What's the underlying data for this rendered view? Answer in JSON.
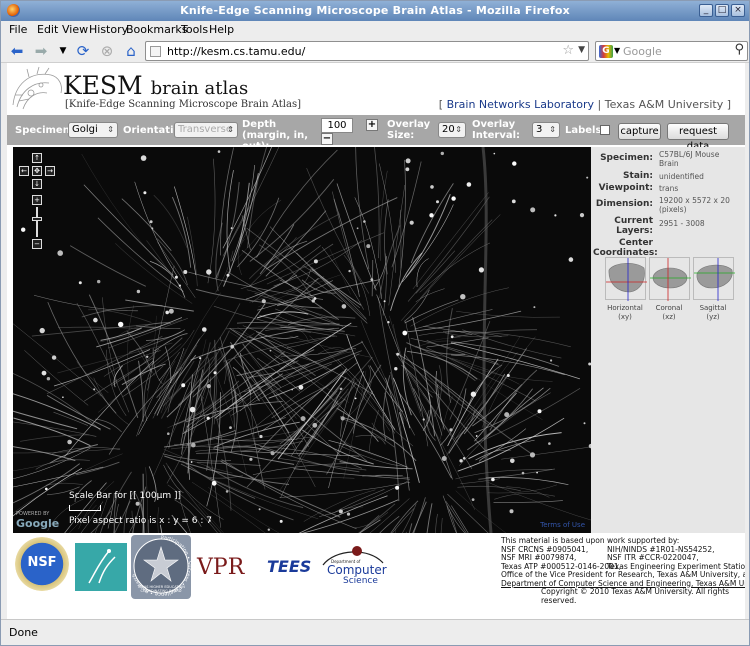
{
  "window": {
    "title": "Knife-Edge Scanning Microscope Brain Atlas - Mozilla Firefox",
    "controls": [
      "_",
      "□",
      "×"
    ]
  },
  "menu": [
    "File",
    "Edit",
    "View",
    "History",
    "Bookmarks",
    "Tools",
    "Help"
  ],
  "nav": {
    "back_icon": "back-arrow-icon",
    "forward_icon": "forward-arrow-icon",
    "reload_icon": "reload-icon",
    "stop_icon": "stop-icon",
    "home_icon": "home-icon",
    "url": "http://kesm.cs.tamu.edu/",
    "search_placeholder": "Google",
    "search_engine_glyph": "G"
  },
  "banner": {
    "logo_big": "KESM",
    "logo_small": "brain atlas",
    "subtitle": "[Knife-Edge Scanning Microscope Brain Atlas]",
    "lab_link": "Brain Networks Laboratory",
    "university": "Texas A&M University",
    "bracket_open": "[",
    "bracket_close": "]",
    "separator": "|"
  },
  "controls": {
    "specimen_label": "Specimen:",
    "specimen_value": "Golgi",
    "orientation_label": "Orientation:",
    "orientation_value": "Transverse",
    "depth_label": "Depth (margin, in, out):",
    "depth_value": "100",
    "plus": "+",
    "minus": "−",
    "overlay_size_label": "Overlay Size:",
    "overlay_size_value": "20",
    "overlay_interval_label": "Overlay Interval:",
    "overlay_interval_value": "3",
    "labels_label": "Labels:",
    "labels_checked": false,
    "capture_button": "capture",
    "request_button": "request data"
  },
  "viewer": {
    "pan_up": "↑",
    "pan_left": "←",
    "pan_center": "✥",
    "pan_right": "→",
    "pan_down": "↓",
    "zoom_in": "+",
    "zoom_out": "−",
    "scale_bar_text": "Scale Bar for [[ 100μm ]]",
    "aspect_text": "Pixel aspect ratio is x : y = 6 : 7",
    "powered_by": "POWERED BY",
    "google_logo": "Google",
    "terms_text": "Terms of Use"
  },
  "info": {
    "specimen_key": "Specimen:",
    "specimen_val": "C57BL/6J Mouse Brain",
    "stain_key": "Stain:",
    "stain_val": "unidentified",
    "viewpoint_key": "Viewpoint:",
    "viewpoint_val": "trans",
    "dimension_key": "Dimension:",
    "dimension_val": "19200 x 5572 x 20 (pixels)",
    "layers_key": "Current Layers:",
    "layers_val": "2951 - 3008",
    "center_key": "Center Coordinates:",
    "thumbs": [
      {
        "label": "Horizontal",
        "axis": "(xy)"
      },
      {
        "label": "Coronal",
        "axis": "(xz)"
      },
      {
        "label": "Sagittal",
        "axis": "(yz)"
      }
    ]
  },
  "footer": {
    "nsf_logo": "NSF",
    "vpr_logo": "VPR",
    "tees_logo": "TEES",
    "cs_logo_small": "Department of",
    "cs_logo_big": "Computer",
    "cs_logo_sci": "Science",
    "thecb_ring": "Participation • Success • Excellence • Research",
    "thecb_text": "TEXAS HIGHER EDUCATION COORDINATING BOARD",
    "funding_intro": "This material is based upon work supported by:",
    "funding_rows": [
      [
        "NSF CRCNS #0905041,",
        "NIH/NINDS #1R01-NS54252,"
      ],
      [
        "NSF MRI #0079874,",
        "NSF ITR #CCR-0220047,"
      ],
      [
        "Texas ATP #000512-0146-2001,",
        "Texas Engineering Experiment Station,"
      ]
    ],
    "funding_line4": "Office of the Vice President for Research, Texas A&M University, and",
    "funding_line5": "Department of Computer Science and Engineering, Texas A&M University",
    "copyright": "Copyright © 2010 Texas A&M University. All rights reserved."
  },
  "status": "Done"
}
